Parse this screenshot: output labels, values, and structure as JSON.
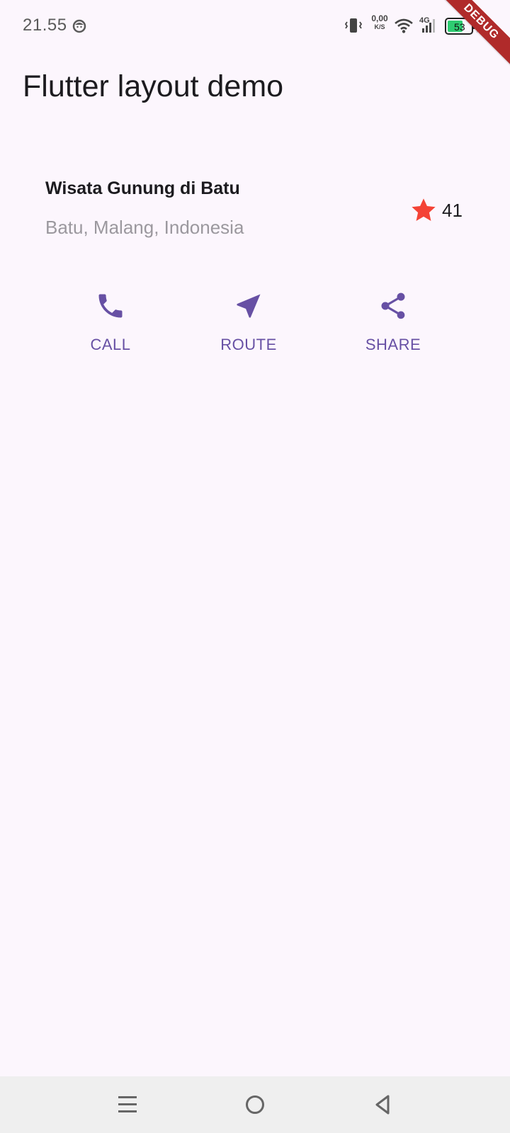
{
  "status_bar": {
    "time": "21.55",
    "net_speed_value": "0,00",
    "net_speed_unit": "K/S",
    "network_type": "4G",
    "battery_level": "53",
    "debug_banner": "DEBUG"
  },
  "app_bar": {
    "title": "Flutter layout demo"
  },
  "title_section": {
    "name": "Wisata Gunung di Batu",
    "location": "Batu, Malang, Indonesia",
    "rating_count": "41",
    "star_icon": "star-icon",
    "star_color": "#f44336"
  },
  "actions": [
    {
      "label": "CALL",
      "icon": "phone-icon"
    },
    {
      "label": "ROUTE",
      "icon": "near-me-icon"
    },
    {
      "label": "SHARE",
      "icon": "share-icon"
    }
  ],
  "colors": {
    "primary": "#6750a4",
    "background": "#fcf6fd",
    "subtitle": "#9b989e",
    "nav_bar": "#efefef"
  },
  "nav_bar": {
    "buttons": [
      "menu-icon",
      "home-icon",
      "back-icon"
    ]
  }
}
